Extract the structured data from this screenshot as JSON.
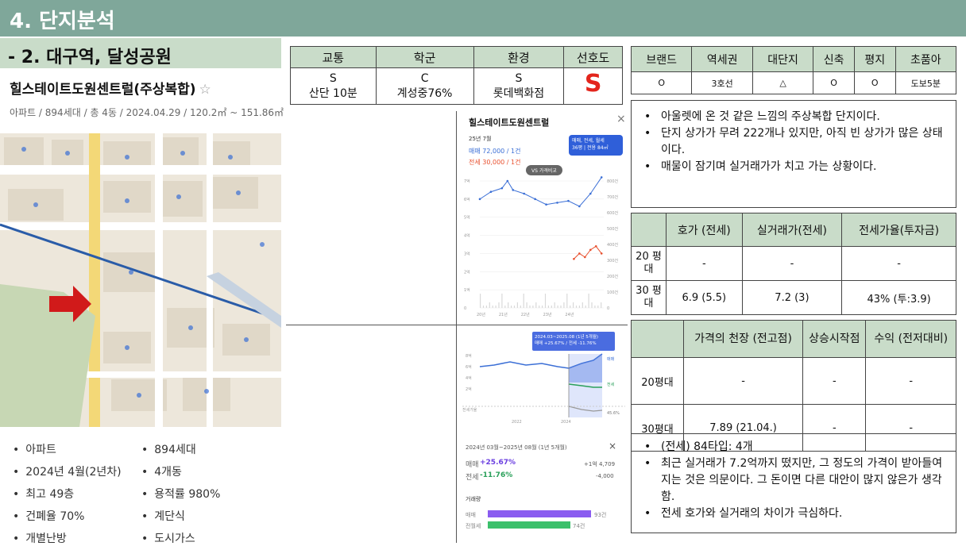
{
  "header": {
    "title": "4. 단지분석"
  },
  "subheader": {
    "title": "- 2. 대구역, 달성공원"
  },
  "complex": {
    "name": "힐스테이트도원센트럴(주상복합)",
    "star": "☆",
    "meta": "아파트 / 894세대 / 총 4동 / 2024.04.29 / 120.2㎡ ~ 151.86㎡"
  },
  "map": {
    "arrow_color": "#d11a1a",
    "rail_color": "#2a5ca8"
  },
  "facts": [
    "아파트",
    "894세대",
    "2024년 4월(2년차)",
    "4개동",
    "최고 49층",
    "용적률 980%",
    "건폐율 70%",
    "계단식",
    "개별난방",
    "도시가스"
  ],
  "eval_table": {
    "headers": [
      "교통",
      "학군",
      "환경",
      "선호도"
    ],
    "cells": [
      {
        "grade": "S",
        "detail": "산단 10분"
      },
      {
        "grade": "C",
        "detail": "계성중76%"
      },
      {
        "grade": "S",
        "detail": "롯데백화점"
      },
      {
        "grade": "S",
        "detail": ""
      }
    ]
  },
  "brand_table": {
    "headers": [
      "브랜드",
      "역세권",
      "대단지",
      "신축",
      "평지",
      "초품아"
    ],
    "values": [
      "O",
      "3호선",
      "△",
      "O",
      "O",
      "도보5분"
    ]
  },
  "notes1": [
    "아울렛에 온 것 같은 느낌의 주상복합 단지이다.",
    "단지 상가가 무려 222개나 있지만, 아직 빈 상가가 많은 상태이다.",
    "매물이 잠기며 실거래가가 치고 가는 상황이다."
  ],
  "price_table": {
    "headers": [
      "",
      "호가 (전세)",
      "실거래가(전세)",
      "전세가율(투자금)"
    ],
    "rows": [
      {
        "label": "20 평대",
        "values": [
          "-",
          "-",
          "-"
        ]
      },
      {
        "label": "30 평대",
        "values": [
          "6.9 (5.5)",
          "7.2 (3)",
          "43% (투:3.9)"
        ]
      }
    ]
  },
  "peak_table": {
    "headers": [
      "",
      "가격의 천장 (전고점)",
      "상승시작점",
      "수익 (전저대비)"
    ],
    "rows": [
      {
        "label": "20평대",
        "values": [
          "-",
          "-",
          "-"
        ]
      },
      {
        "label": "30평대",
        "values": [
          "7.89 (21.04.)",
          "-",
          "-"
        ]
      }
    ]
  },
  "notes2": [
    "(전세) 84타입: 4개",
    "최근 실거래가 7.2억까지 떴지만, 그 정도의 가격이 받아들여지는 것은 의문이다. 그 돈이면 다른 대안이 많지 않은가 생각함.",
    "전세 호가와 실거래의 차이가 극심하다."
  ],
  "panel": {
    "title": "힐스테이트도원센트럴",
    "close": "×",
    "month": "25년 7월",
    "sale": "매매 72,000 / 1건",
    "jeonse": "전세 30,000 / 1건",
    "badge_top": "매매, 전세, 월세",
    "badge_bottom": "36평 | 전용 84㎡",
    "vs_button": "VS 가격비교",
    "y_left": [
      "7억",
      "6억",
      "5억",
      "4억",
      "3억",
      "2억",
      "1억",
      "0"
    ],
    "y_right": [
      "800건",
      "700건",
      "600건",
      "500건",
      "400건",
      "300건",
      "200건",
      "100건",
      "0"
    ],
    "x_labels": [
      "20년",
      "21년",
      "22년",
      "23년",
      "24년"
    ],
    "sale_color": "#3b6fd6",
    "jeonse_color": "#e8502e"
  },
  "chart_data": {
    "type": "line",
    "title": "",
    "series": [
      {
        "name": "매매",
        "x": [
          "20.01",
          "20.07",
          "21.01",
          "21.04",
          "21.07",
          "22.01",
          "22.07",
          "23.01",
          "23.07",
          "24.01",
          "24.07",
          "25.01",
          "25.07"
        ],
        "values": [
          6.0,
          6.4,
          6.6,
          7.0,
          6.5,
          6.3,
          6.0,
          5.7,
          5.8,
          5.9,
          5.6,
          6.3,
          7.2
        ]
      },
      {
        "name": "전세",
        "x": [
          "24.04",
          "24.07",
          "24.10",
          "25.01",
          "25.04",
          "25.07"
        ],
        "values": [
          2.7,
          3.0,
          2.8,
          3.2,
          3.4,
          3.0
        ]
      }
    ],
    "ylabel": "",
    "ylim": [
      0,
      7
    ],
    "grid": true
  },
  "period_popup": {
    "label": "2024.03~2025.08 (1년 5개월)",
    "sale": "매매 +25.67%",
    "sep": "/",
    "jeonse": "전세 -11.76%",
    "y_labels": [
      "8억",
      "6억",
      "4억",
      "2억",
      "전세가율"
    ],
    "x_labels": [
      "2022",
      "2024"
    ],
    "tags": [
      "매매",
      "전세",
      "45.6%"
    ]
  },
  "stats": {
    "period": "2024년 03월~2025년 08월 (1년 5개월)",
    "close": "×",
    "sale_label": "매매",
    "sale_pct": "+25.67%",
    "sale_amt": "+1억 4,709",
    "jeonse_label": "전세",
    "jeonse_pct": "-11.76%",
    "jeonse_amt": "-4,000",
    "volume_title": "거래량",
    "vol": [
      {
        "label": "매매",
        "count": "93건",
        "ratio": 1.0,
        "color": "#8a5cf0"
      },
      {
        "label": "전월세",
        "count": "74건",
        "ratio": 0.8,
        "color": "#3cc06b"
      }
    ]
  }
}
